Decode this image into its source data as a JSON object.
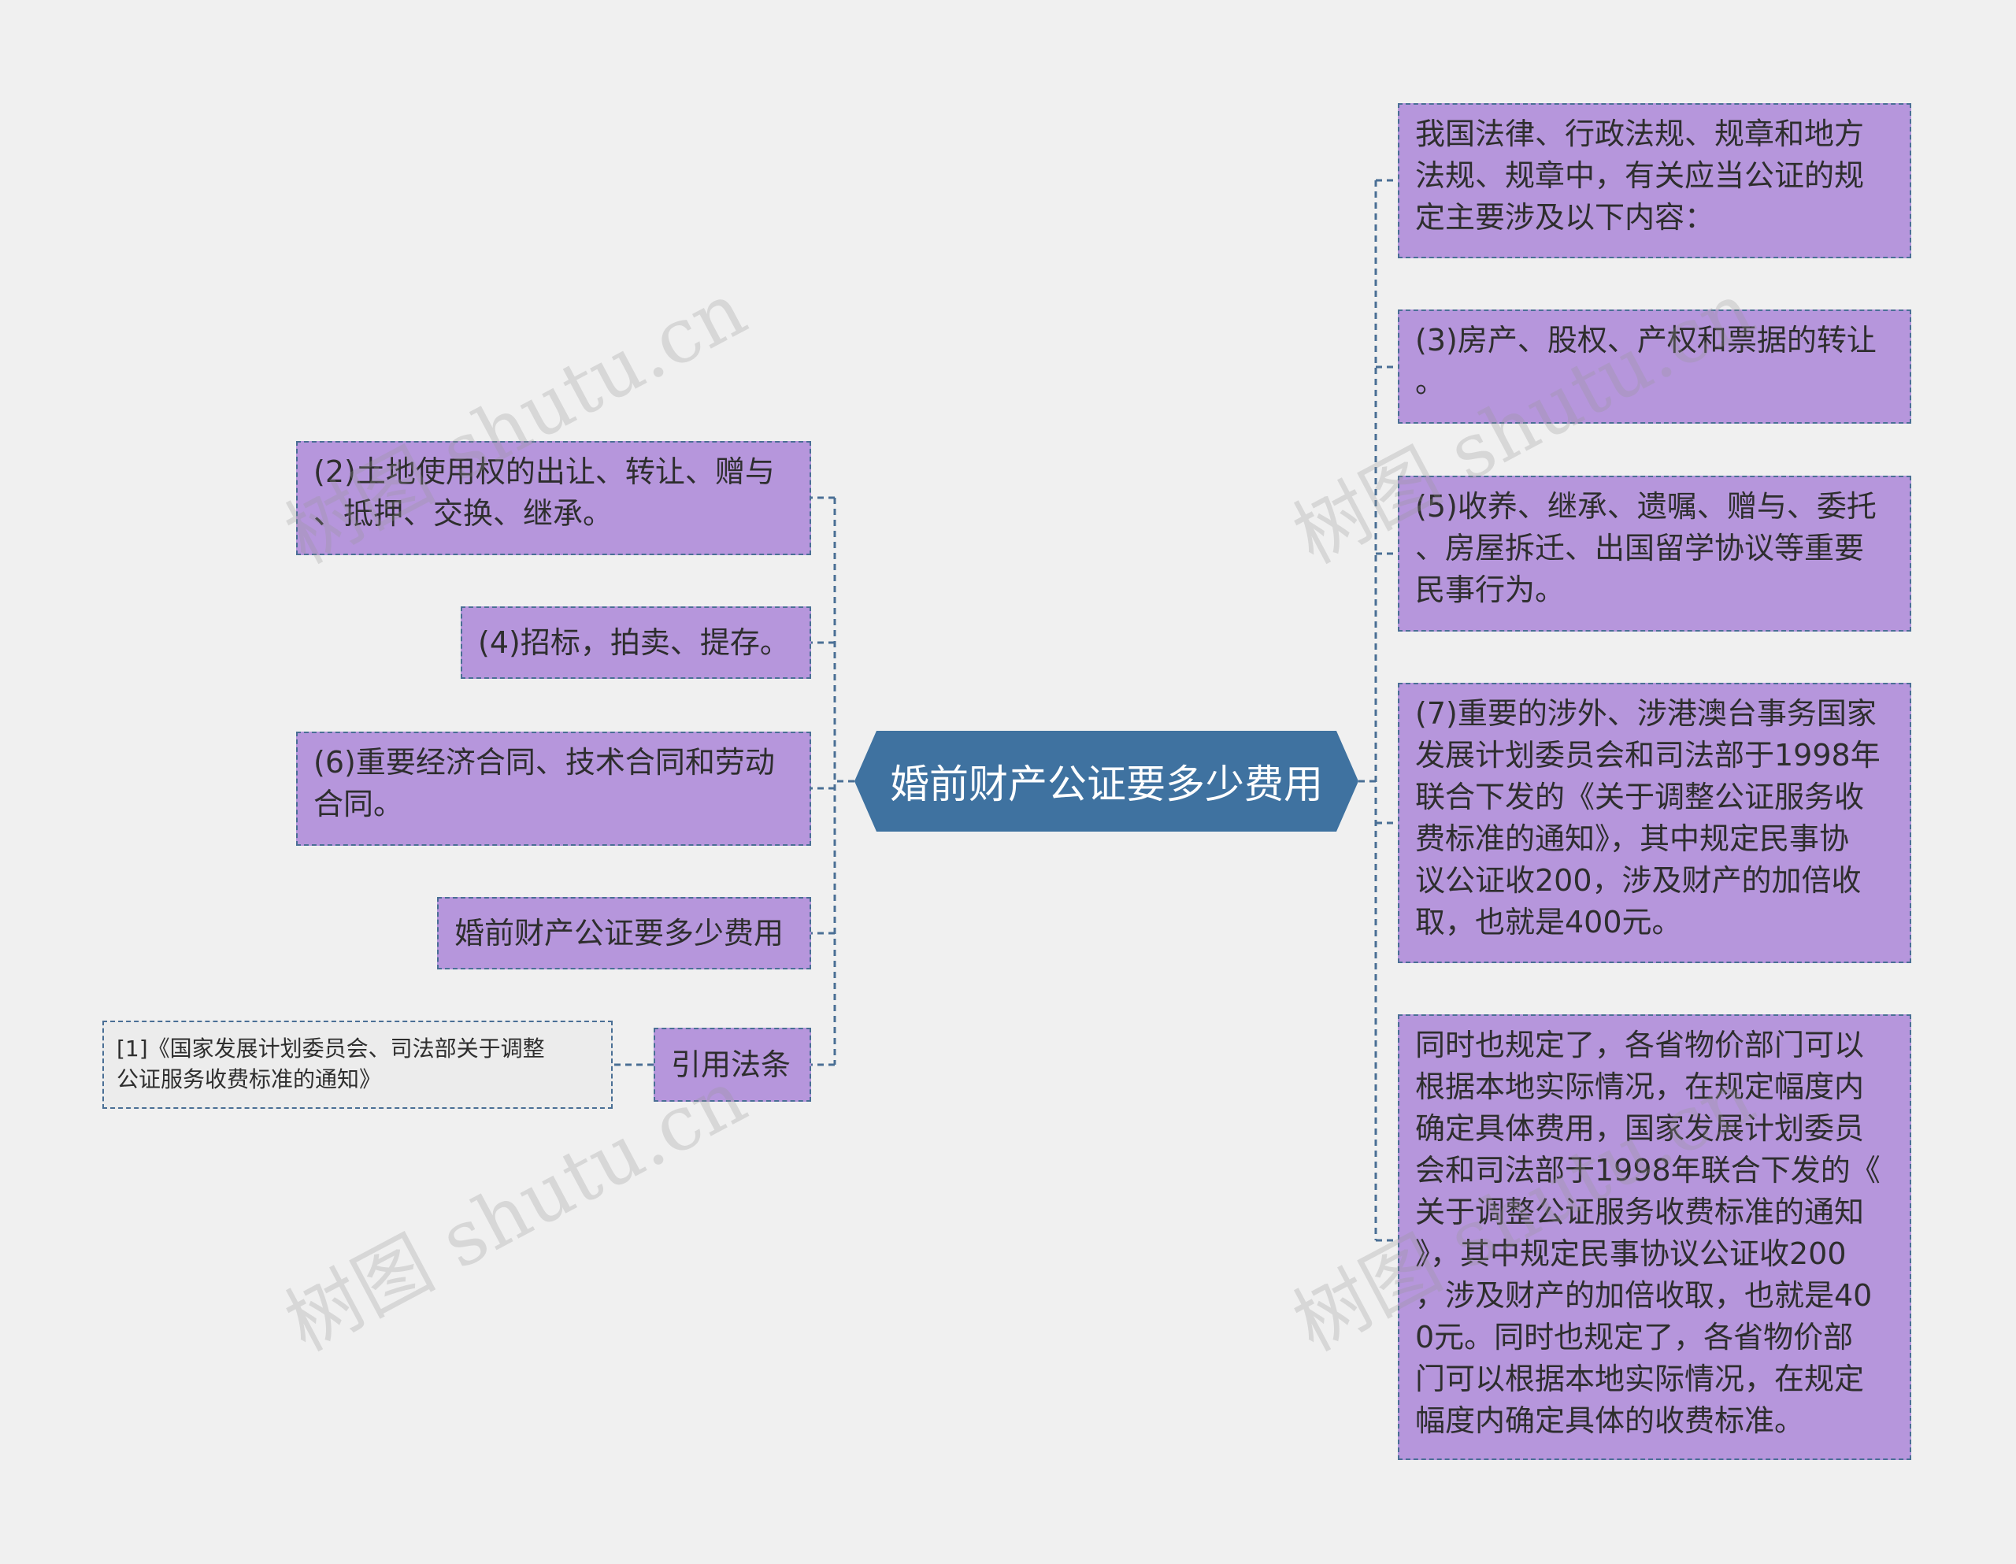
{
  "center": {
    "title": "婚前财产公证要多少费用"
  },
  "left_nodes": [
    {
      "text": "(2)土地使用权的出让、转让、赠与\n、抵押、交换、继承。"
    },
    {
      "text": "(4)招标，拍卖、提存。"
    },
    {
      "text": "(6)重要经济合同、技术合同和劳动\n合同。"
    },
    {
      "text": "婚前财产公证要多少费用"
    },
    {
      "text": "引用法条"
    }
  ],
  "reference": {
    "text": "[1]《国家发展计划委员会、司法部关于调整\n公证服务收费标准的通知》"
  },
  "right_nodes": [
    {
      "text": "我国法律、行政法规、规章和地方\n法规、规章中，有关应当公证的规\n定主要涉及以下内容："
    },
    {
      "text": "(3)房产、股权、产权和票据的转让\n。"
    },
    {
      "text": "(5)收养、继承、遗嘱、赠与、委托\n、房屋拆迁、出国留学协议等重要\n民事行为。"
    },
    {
      "text": "(7)重要的涉外、涉港澳台事务国家\n发展计划委员会和司法部于1998年\n联合下发的《关于调整公证服务收\n费标准的通知》，其中规定民事协\n议公证收200，涉及财产的加倍收\n取，也就是400元。"
    },
    {
      "text": "同时也规定了，各省物价部门可以\n根据本地实际情况，在规定幅度内\n确定具体费用，国家发展计划委员\n会和司法部于1998年联合下发的《\n关于调整公证服务收费标准的通知\n》，其中规定民事协议公证收200\n，涉及财产的加倍收取，也就是40\n0元。同时也规定了，各省物价部\n门可以根据本地实际情况，在规定\n幅度内确定具体的收费标准。"
    }
  ],
  "watermark": {
    "text": "树图 shutu.cn"
  },
  "colors": {
    "node_fill": "#b696dc",
    "center_fill": "#3f72a0",
    "connector": "#4a6f95",
    "background": "#f0f0f0"
  }
}
